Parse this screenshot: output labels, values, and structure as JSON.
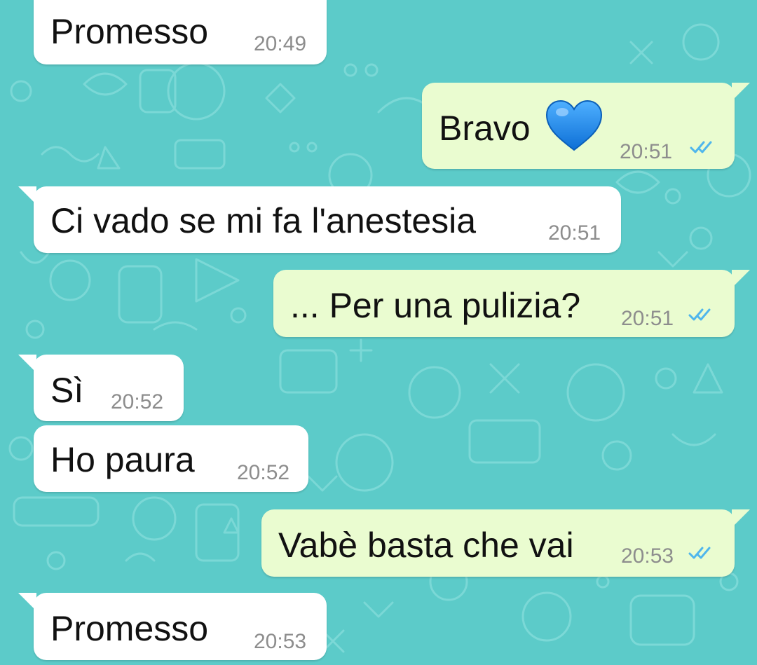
{
  "theme": {
    "wallpaper_color": "#5ccbc9",
    "incoming_bubble_color": "#ffffff",
    "outgoing_bubble_color": "#eafcd0",
    "read_tick_color": "#4fb6ec",
    "heart_color": "#1e88e5"
  },
  "messages": [
    {
      "direction": "incoming",
      "text": "Promesso",
      "time": "20:49"
    },
    {
      "direction": "outgoing",
      "text": "Bravo",
      "emoji": "blue-heart",
      "time": "20:51",
      "status": "read"
    },
    {
      "direction": "incoming",
      "text": "Ci vado se mi fa l'anestesia",
      "time": "20:51"
    },
    {
      "direction": "outgoing",
      "text": "... Per una pulizia?",
      "time": "20:51",
      "status": "read"
    },
    {
      "direction": "incoming",
      "text": "Sì",
      "time": "20:52"
    },
    {
      "direction": "incoming",
      "text": "Ho paura",
      "time": "20:52"
    },
    {
      "direction": "outgoing",
      "text": "Vabè basta che vai",
      "time": "20:53",
      "status": "read"
    },
    {
      "direction": "incoming",
      "text": "Promesso",
      "time": "20:53"
    }
  ]
}
